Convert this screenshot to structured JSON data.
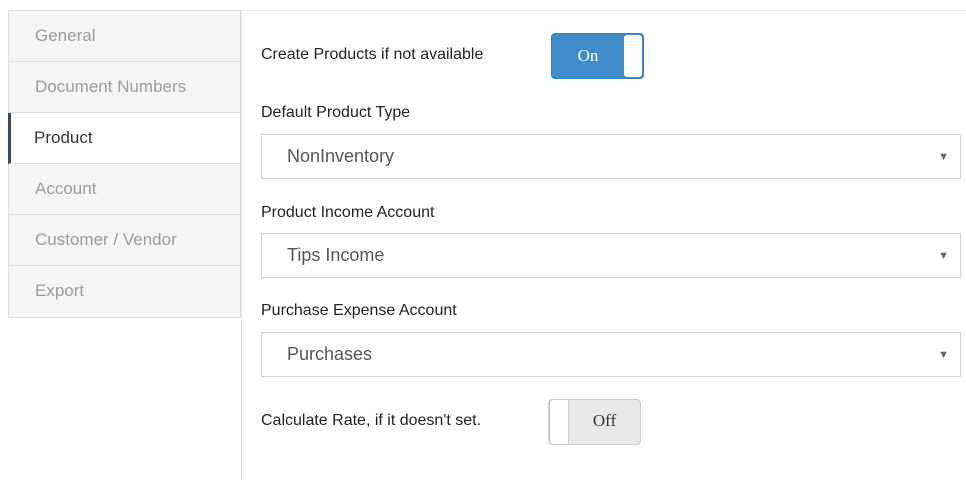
{
  "sidebar": {
    "items": [
      {
        "label": "General"
      },
      {
        "label": "Document Numbers"
      },
      {
        "label": "Product"
      },
      {
        "label": "Account"
      },
      {
        "label": "Customer / Vendor"
      },
      {
        "label": "Export"
      }
    ],
    "active": "Product"
  },
  "form": {
    "create_products": {
      "label": "Create Products if not available",
      "state": "On"
    },
    "default_product_type": {
      "label": "Default Product Type",
      "value": "NonInventory"
    },
    "product_income_account": {
      "label": "Product Income Account",
      "value": "Tips Income"
    },
    "purchase_expense_account": {
      "label": "Purchase Expense Account",
      "value": "Purchases"
    },
    "calculate_rate": {
      "label": "Calculate Rate, if it doesn't set.",
      "state": "Off"
    }
  },
  "colors": {
    "toggle_on": "#428bca",
    "active_indicator": "#3d4a5c",
    "sidebar_bg": "#f5f5f5"
  },
  "icons": {
    "select_caret": "caret-down-icon"
  }
}
